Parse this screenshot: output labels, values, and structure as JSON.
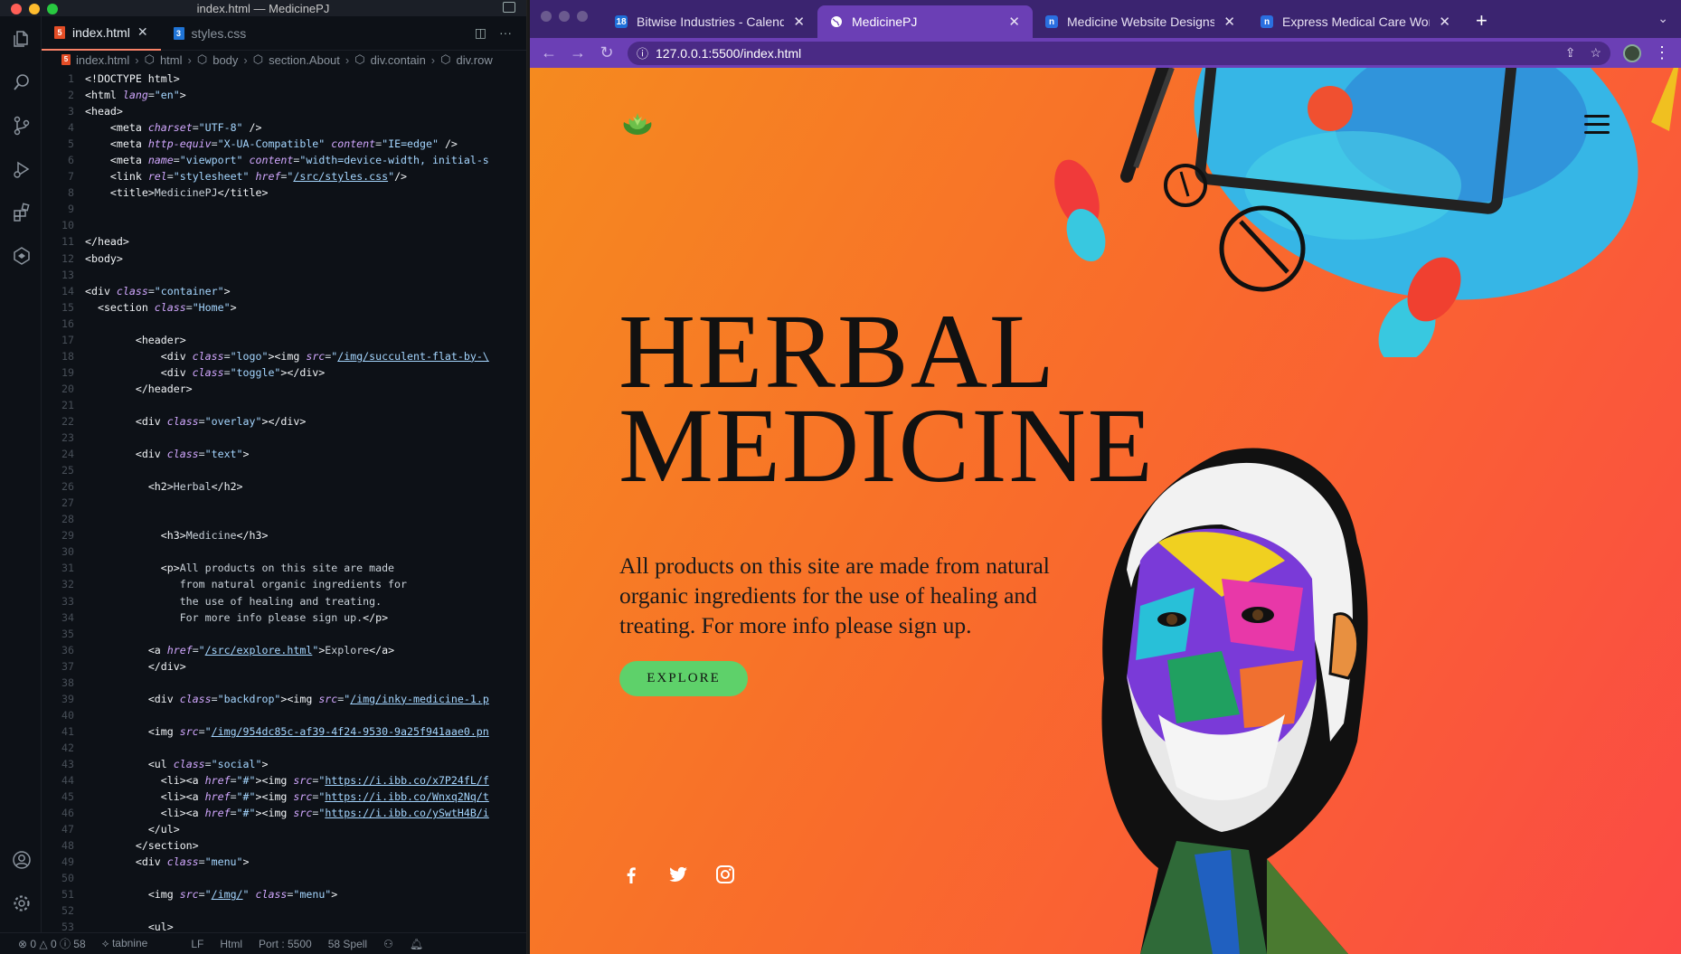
{
  "vscode": {
    "window_title": "index.html — MedicinePJ",
    "tabs": [
      {
        "label": "index.html",
        "active": true
      },
      {
        "label": "styles.css",
        "active": false
      }
    ],
    "breadcrumb": [
      "index.html",
      "html",
      "body",
      "section.About",
      "div.contain",
      "div.row"
    ],
    "code_lines": [
      {
        "n": "1",
        "html": "<span class=\"tg\">&lt;!DOCTYPE html&gt;</span>"
      },
      {
        "n": "2",
        "html": "<span class=\"tg\">&lt;html</span> <span class=\"at\">lang</span>=<span class=\"st\">\"en\"</span><span class=\"tg\">&gt;</span>"
      },
      {
        "n": "3",
        "html": "<span class=\"tg\">&lt;head&gt;</span>"
      },
      {
        "n": "4",
        "html": "    <span class=\"tg\">&lt;meta</span> <span class=\"at\">charset</span>=<span class=\"st\">\"UTF-8\"</span> <span class=\"tg\">/&gt;</span>"
      },
      {
        "n": "5",
        "html": "    <span class=\"tg\">&lt;meta</span> <span class=\"at\">http-equiv</span>=<span class=\"st\">\"X-UA-Compatible\"</span> <span class=\"at\">content</span>=<span class=\"st\">\"IE=edge\"</span> <span class=\"tg\">/&gt;</span>"
      },
      {
        "n": "6",
        "html": "    <span class=\"tg\">&lt;meta</span> <span class=\"at\">name</span>=<span class=\"st\">\"viewport\"</span> <span class=\"at\">content</span>=<span class=\"st\">\"width=device-width, initial-s</span>"
      },
      {
        "n": "7",
        "html": "    <span class=\"tg\">&lt;link</span> <span class=\"at\">rel</span>=<span class=\"st\">\"stylesheet\"</span> <span class=\"at\">href</span>=<span class=\"st\">\"</span><span class=\"lk\">/src/styles.css</span><span class=\"st\">\"</span><span class=\"tg\">/&gt;</span>"
      },
      {
        "n": "8",
        "html": "    <span class=\"tg\">&lt;title&gt;</span>MedicinePJ<span class=\"tg\">&lt;/title&gt;</span>"
      },
      {
        "n": "9",
        "html": ""
      },
      {
        "n": "10",
        "html": ""
      },
      {
        "n": "11",
        "html": "<span class=\"tg\">&lt;/head&gt;</span>"
      },
      {
        "n": "12",
        "html": "<span class=\"tg\">&lt;body&gt;</span>"
      },
      {
        "n": "13",
        "html": ""
      },
      {
        "n": "14",
        "html": "<span class=\"tg\">&lt;div</span> <span class=\"at\">class</span>=<span class=\"st\">\"container\"</span><span class=\"tg\">&gt;</span>"
      },
      {
        "n": "15",
        "html": "  <span class=\"tg\">&lt;section</span> <span class=\"at\">class</span>=<span class=\"st\">\"Home\"</span><span class=\"tg\">&gt;</span>"
      },
      {
        "n": "16",
        "html": ""
      },
      {
        "n": "17",
        "html": "        <span class=\"tg\">&lt;header&gt;</span>"
      },
      {
        "n": "18",
        "html": "            <span class=\"tg\">&lt;div</span> <span class=\"at\">class</span>=<span class=\"st\">\"logo\"</span><span class=\"tg\">&gt;&lt;img</span> <span class=\"at\">src</span>=<span class=\"st\">\"</span><span class=\"lk\">/img/succulent-flat-by-\\</span>"
      },
      {
        "n": "19",
        "html": "            <span class=\"tg\">&lt;div</span> <span class=\"at\">class</span>=<span class=\"st\">\"toggle\"</span><span class=\"tg\">&gt;&lt;/div&gt;</span>"
      },
      {
        "n": "20",
        "html": "        <span class=\"tg\">&lt;/header&gt;</span>"
      },
      {
        "n": "21",
        "html": ""
      },
      {
        "n": "22",
        "html": "        <span class=\"tg\">&lt;div</span> <span class=\"at\">class</span>=<span class=\"st\">\"overlay\"</span><span class=\"tg\">&gt;&lt;/div&gt;</span>"
      },
      {
        "n": "23",
        "html": ""
      },
      {
        "n": "24",
        "html": "        <span class=\"tg\">&lt;div</span> <span class=\"at\">class</span>=<span class=\"st\">\"text\"</span><span class=\"tg\">&gt;</span>"
      },
      {
        "n": "25",
        "html": ""
      },
      {
        "n": "26",
        "html": "          <span class=\"tg\">&lt;h2&gt;</span>Herbal<span class=\"tg\">&lt;/h2&gt;</span>"
      },
      {
        "n": "27",
        "html": ""
      },
      {
        "n": "28",
        "html": ""
      },
      {
        "n": "29",
        "html": "            <span class=\"tg\">&lt;h3&gt;</span>Medicine<span class=\"tg\">&lt;/h3&gt;</span>"
      },
      {
        "n": "30",
        "html": ""
      },
      {
        "n": "31",
        "html": "            <span class=\"tg\">&lt;p&gt;</span>All products on this site are made"
      },
      {
        "n": "32",
        "html": "               from natural organic ingredients for"
      },
      {
        "n": "33",
        "html": "               the use of healing and treating."
      },
      {
        "n": "34",
        "html": "               For more info please sign up.<span class=\"tg\">&lt;/p&gt;</span>"
      },
      {
        "n": "35",
        "html": ""
      },
      {
        "n": "36",
        "html": "          <span class=\"tg\">&lt;a</span> <span class=\"at\">href</span>=<span class=\"st\">\"</span><span class=\"lk\">/src/explore.html</span><span class=\"st\">\"</span><span class=\"tg\">&gt;</span>Explore<span class=\"tg\">&lt;/a&gt;</span>"
      },
      {
        "n": "37",
        "html": "          <span class=\"tg\">&lt;/div&gt;</span>"
      },
      {
        "n": "38",
        "html": ""
      },
      {
        "n": "39",
        "html": "          <span class=\"tg\">&lt;div</span> <span class=\"at\">class</span>=<span class=\"st\">\"backdrop\"</span><span class=\"tg\">&gt;&lt;img</span> <span class=\"at\">src</span>=<span class=\"st\">\"</span><span class=\"lk\">/img/inky-medicine-1.p</span>"
      },
      {
        "n": "40",
        "html": ""
      },
      {
        "n": "41",
        "html": "          <span class=\"tg\">&lt;img</span> <span class=\"at\">src</span>=<span class=\"st\">\"</span><span class=\"lk\">/img/954dc85c-af39-4f24-9530-9a25f941aae0.pn</span>"
      },
      {
        "n": "42",
        "html": ""
      },
      {
        "n": "43",
        "html": "          <span class=\"tg\">&lt;ul</span> <span class=\"at\">class</span>=<span class=\"st\">\"social\"</span><span class=\"tg\">&gt;</span>"
      },
      {
        "n": "44",
        "html": "            <span class=\"tg\">&lt;li&gt;&lt;a</span> <span class=\"at\">href</span>=<span class=\"st\">\"#\"</span><span class=\"tg\">&gt;&lt;img</span> <span class=\"at\">src</span>=<span class=\"st\">\"</span><span class=\"lk\">https://i.ibb.co/x7P24fL/f</span>"
      },
      {
        "n": "45",
        "html": "            <span class=\"tg\">&lt;li&gt;&lt;a</span> <span class=\"at\">href</span>=<span class=\"st\">\"#\"</span><span class=\"tg\">&gt;&lt;img</span> <span class=\"at\">src</span>=<span class=\"st\">\"</span><span class=\"lk\">https://i.ibb.co/Wnxq2Nq/t</span>"
      },
      {
        "n": "46",
        "html": "            <span class=\"tg\">&lt;li&gt;&lt;a</span> <span class=\"at\">href</span>=<span class=\"st\">\"#\"</span><span class=\"tg\">&gt;&lt;img</span> <span class=\"at\">src</span>=<span class=\"st\">\"</span><span class=\"lk\">https://i.ibb.co/ySwtH4B/i</span>"
      },
      {
        "n": "47",
        "html": "          <span class=\"tg\">&lt;/ul&gt;</span>"
      },
      {
        "n": "48",
        "html": "        <span class=\"tg\">&lt;/section&gt;</span>"
      },
      {
        "n": "49",
        "html": "        <span class=\"tg\">&lt;div</span> <span class=\"at\">class</span>=<span class=\"st\">\"menu\"</span><span class=\"tg\">&gt;</span>"
      },
      {
        "n": "50",
        "html": ""
      },
      {
        "n": "51",
        "html": "          <span class=\"tg\">&lt;img</span> <span class=\"at\">src</span>=<span class=\"st\">\"</span><span class=\"lk\">/img/</span><span class=\"st\">\"</span> <span class=\"at\">class</span>=<span class=\"st\">\"menu\"</span><span class=\"tg\">&gt;</span>"
      },
      {
        "n": "52",
        "html": ""
      },
      {
        "n": "53",
        "html": "          <span class=\"tg\">&lt;ul&gt;</span>"
      }
    ],
    "status": {
      "problems": "⊗ 0 △ 0 ⓘ 58",
      "tabnine": "tabnine",
      "eol": "LF",
      "language": "Html",
      "port": "Port : 5500",
      "spell": "58 Spell"
    }
  },
  "browser": {
    "tabs": [
      {
        "title": "Bitwise Industries - Calendar - ",
        "icon": "calendar-icon",
        "active": false
      },
      {
        "title": "MedicinePJ",
        "icon": "globe-icon",
        "active": true
      },
      {
        "title": "Medicine Website Designs",
        "icon": "notion-icon",
        "active": false
      },
      {
        "title": "Express Medical Care WordPre",
        "icon": "notion-icon",
        "active": false
      }
    ],
    "url": "127.0.0.1:5500/index.html",
    "accent": "#6b3fb5"
  },
  "page": {
    "title_line1": "HERBAL",
    "title_line2": "MEDICINE",
    "paragraph": "All products on this site are made from natural organic ingredients for the use of healing and treating. For more info please sign up.",
    "explore_label": "EXPLORE",
    "social": [
      "facebook-icon",
      "twitter-icon",
      "instagram-icon"
    ],
    "button_color": "#5ed16a"
  }
}
